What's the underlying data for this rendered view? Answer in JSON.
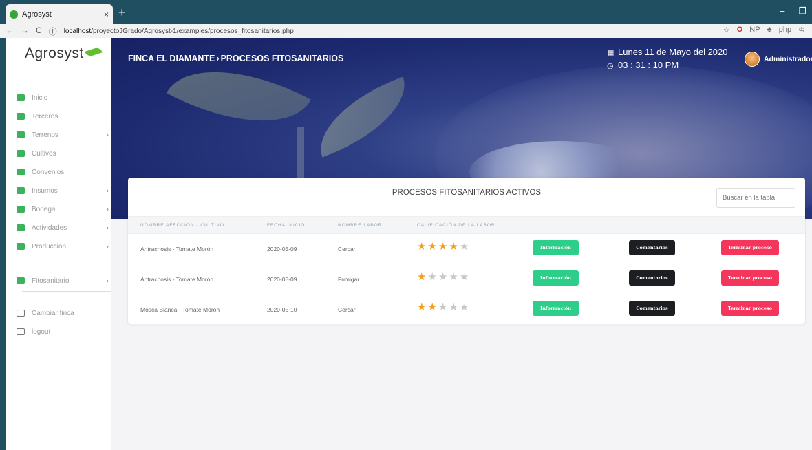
{
  "browser": {
    "tab_title": "Agrosyst",
    "tab_close": "×",
    "new_tab": "+",
    "url_prefix": "localhost/",
    "url_path": "proyectoJGrado/Agrosyst-1/examples/procesos_fitosanitarios.php",
    "ext_labels": [
      "☆",
      "O",
      "NP",
      "♣",
      "php",
      "♔"
    ]
  },
  "sidebar": {
    "logo": "Agrosyst",
    "items": [
      {
        "label": "Inicio",
        "icon": "home-icon",
        "chevron": ""
      },
      {
        "label": "Terceros",
        "icon": "users-icon",
        "chevron": ""
      },
      {
        "label": "Terrenos",
        "icon": "terrain-icon",
        "chevron": "›"
      },
      {
        "label": "Cultivos",
        "icon": "plant-icon",
        "chevron": ""
      },
      {
        "label": "Convenios",
        "icon": "handshake-icon",
        "chevron": ""
      },
      {
        "label": "Insumos",
        "icon": "boxes-icon",
        "chevron": "›"
      },
      {
        "label": "Bodega",
        "icon": "warehouse-icon",
        "chevron": "›"
      },
      {
        "label": "Actividades",
        "icon": "tasks-icon",
        "chevron": "›"
      },
      {
        "label": "Producción",
        "icon": "leaf-icon",
        "chevron": "›"
      },
      {
        "label": "Fitosanitario",
        "icon": "spray-icon",
        "chevron": "›"
      },
      {
        "label": "Cambiar finca",
        "icon": "swap-icon",
        "chevron": ""
      },
      {
        "label": "logout",
        "icon": "logout-icon",
        "chevron": ""
      }
    ]
  },
  "header": {
    "farm": "FINCA EL DIAMANTE",
    "separator": "›",
    "section": "PROCESOS FITOSANITARIOS",
    "date": "Lunes 11 de Mayo del 2020",
    "time": "03 : 31 : 10 PM",
    "user": "Administrador"
  },
  "card": {
    "title": "PROCESOS FITOSANITARIOS ACTIVOS",
    "search_placeholder": "Buscar en la tabla",
    "columns": [
      "NOMBRE AFECCION - CULTIVO",
      "FECHA INICIO",
      "NOMBRE LABOR",
      "CALIFICACIÓN DE LA LABOR"
    ],
    "buttons": {
      "info": "Información",
      "comments": "Comentarios",
      "finish": "Terminar proceso"
    },
    "rows": [
      {
        "afeccion": "Antracnosis - Tomate Morón",
        "fecha": "2020-05-09",
        "labor": "Cercar",
        "rating": 4
      },
      {
        "afeccion": "Antracnosis - Tomate Morón",
        "fecha": "2020-05-09",
        "labor": "Fumigar",
        "rating": 1
      },
      {
        "afeccion": "Mosca Blanca - Tomate Morón",
        "fecha": "2020-05-10",
        "labor": "Cercar",
        "rating": 2
      }
    ],
    "rating_max": 5
  },
  "colors": {
    "info": "#2dce89",
    "comments": "#1c1e22",
    "finish": "#f5365c",
    "star": "#f59e1b",
    "sidebar_icon": "#3bb25b"
  }
}
